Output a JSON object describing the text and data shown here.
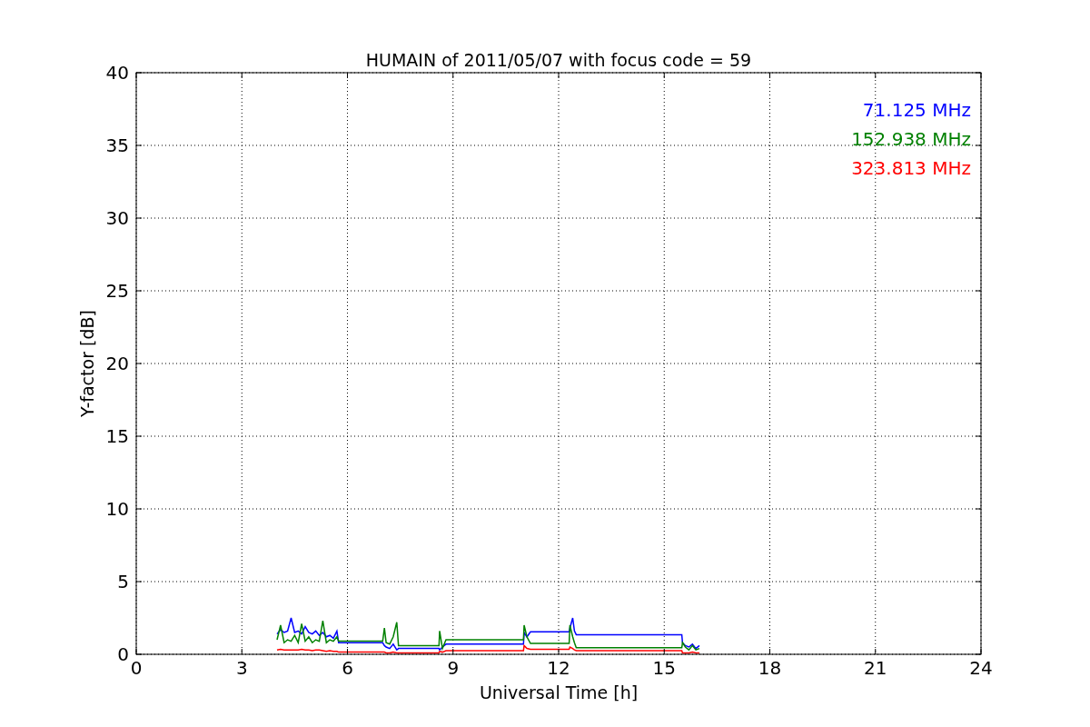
{
  "chart_data": {
    "type": "line",
    "title": "HUMAIN of 2011/05/07 with focus code = 59",
    "xlabel": "Universal Time [h]",
    "ylabel": "Y-factor [dB]",
    "x": [
      4.0,
      4.1,
      4.2,
      4.3,
      4.4,
      4.5,
      4.6,
      4.7,
      4.8,
      4.9,
      5.0,
      5.1,
      5.2,
      5.3,
      5.4,
      5.5,
      5.6,
      5.7,
      5.75,
      7.0,
      7.05,
      7.1,
      7.2,
      7.3,
      7.4,
      7.45,
      8.6,
      8.62,
      8.7,
      8.8,
      11.0,
      11.02,
      11.1,
      11.2,
      12.3,
      12.32,
      12.4,
      12.45,
      12.5,
      15.5,
      15.52,
      15.6,
      15.7,
      15.8,
      15.9,
      16.0
    ],
    "series": [
      {
        "name": "71.125 MHz",
        "color": "#0000ff",
        "values": [
          1.4,
          1.7,
          1.5,
          1.6,
          2.5,
          1.5,
          1.6,
          1.4,
          1.9,
          1.5,
          1.4,
          1.6,
          1.3,
          1.5,
          1.2,
          1.3,
          1.1,
          1.6,
          0.8,
          0.8,
          0.6,
          0.5,
          0.4,
          0.7,
          0.3,
          0.4,
          0.4,
          0.3,
          0.5,
          0.7,
          0.7,
          1.5,
          1.2,
          1.55,
          1.55,
          1.8,
          2.5,
          1.6,
          1.35,
          1.35,
          0.8,
          0.6,
          0.5,
          0.7,
          0.4,
          0.6
        ]
      },
      {
        "name": "152.938 MHz",
        "color": "#008000",
        "values": [
          1.0,
          2.0,
          0.8,
          1.0,
          0.9,
          1.3,
          0.8,
          2.1,
          0.9,
          1.2,
          0.8,
          1.0,
          0.9,
          2.3,
          0.8,
          1.0,
          0.9,
          1.2,
          0.9,
          0.9,
          1.8,
          0.8,
          0.7,
          1.2,
          2.2,
          0.6,
          0.6,
          1.6,
          0.4,
          1.0,
          1.0,
          2.0,
          1.2,
          0.75,
          0.75,
          2.0,
          1.2,
          0.8,
          0.45,
          0.45,
          0.8,
          0.5,
          0.3,
          0.6,
          0.3,
          0.4
        ]
      },
      {
        "name": "323.813 MHz",
        "color": "#ff0000",
        "values": [
          0.3,
          0.35,
          0.3,
          0.3,
          0.3,
          0.3,
          0.3,
          0.35,
          0.3,
          0.3,
          0.25,
          0.3,
          0.3,
          0.25,
          0.2,
          0.25,
          0.2,
          0.2,
          0.15,
          0.15,
          0.15,
          0.1,
          0.1,
          0.15,
          0.1,
          0.1,
          0.1,
          0.2,
          0.15,
          0.25,
          0.25,
          0.6,
          0.4,
          0.35,
          0.35,
          0.5,
          0.4,
          0.3,
          0.25,
          0.25,
          0.1,
          0.1,
          0.1,
          0.15,
          0.1,
          0.1
        ]
      }
    ],
    "xlim": [
      0,
      24
    ],
    "ylim": [
      0,
      40
    ],
    "xticks": [
      0,
      3,
      6,
      9,
      12,
      15,
      18,
      21,
      24
    ],
    "yticks": [
      0,
      5,
      10,
      15,
      20,
      25,
      30,
      35,
      40
    ],
    "grid": true
  }
}
